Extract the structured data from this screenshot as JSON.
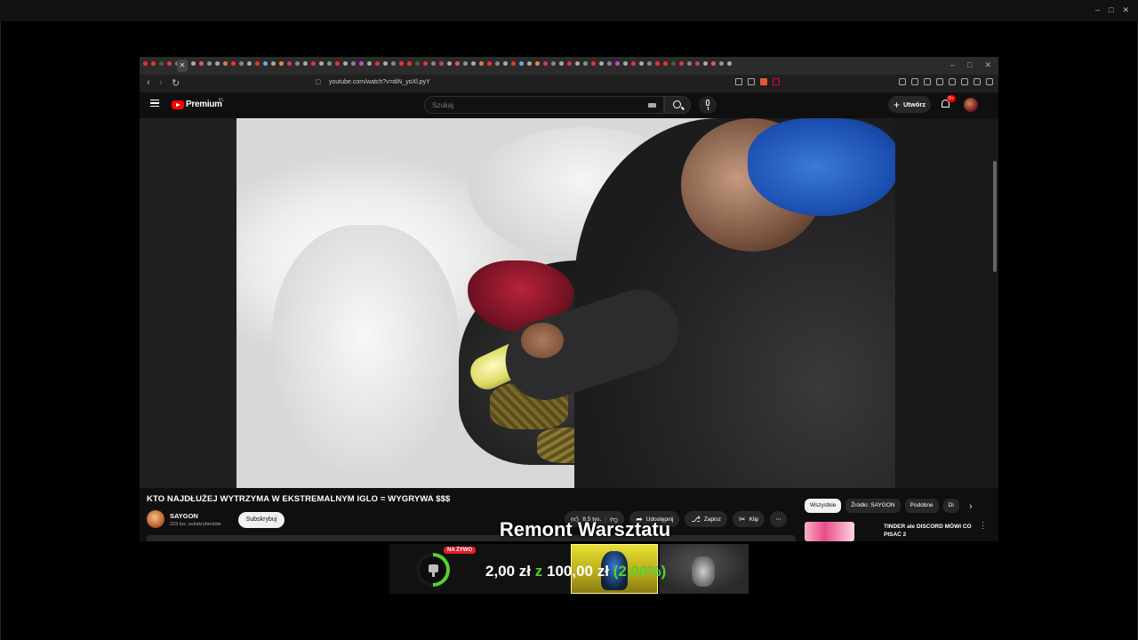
{
  "browser": {
    "url": "youtube.com/watch?v=diN_yoXl.pyY"
  },
  "header": {
    "logo_text": "Premium",
    "country": "PL",
    "search_placeholder": "Szukaj",
    "create_label": "Utwórz",
    "notif_count": "9+"
  },
  "video": {
    "title": "KTO NAJDŁUŻEJ WYTRZYMA W EKSTREMALNYM IGLO = WYGRYWA $$$",
    "channel": "SAYGON",
    "subscribers": "223 tys. subskrybentów",
    "subscribe_label": "Subskrybuj",
    "likes": "8,5 tys.",
    "share_label": "Udostępnij",
    "save_label": "Zapisz",
    "clip_label": "Klip"
  },
  "chips": [
    "Wszystkie",
    "Źródło: SAYGON",
    "Podobne",
    "Di"
  ],
  "recommendation": {
    "title": "TINDER ale DISCORD MÓWI CO PISAĆ 2"
  },
  "overlay": {
    "title": "Remont Warsztatu",
    "live_badge": "NA ŻYWO",
    "current": "2,00 zł",
    "separator": "z",
    "target": "100,00 zł",
    "percent": "(2.00%)",
    "progress": 0.02
  },
  "colors": {
    "youtube_red": "#ff0000",
    "goal_green": "#55d12f",
    "live_red": "#e01d2a",
    "background": "#0f0f0f"
  }
}
